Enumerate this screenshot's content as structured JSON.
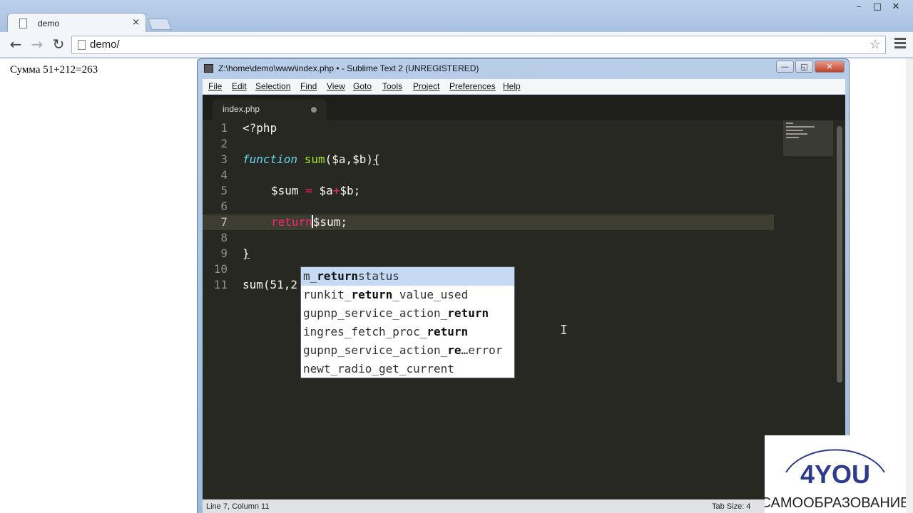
{
  "browser": {
    "tab_title": "demo",
    "tab_close": "×",
    "url": "demo/",
    "window_controls": [
      "–",
      "□",
      "✕"
    ],
    "nav": {
      "back": "←",
      "forward": "→",
      "reload": "↻",
      "star": "☆"
    }
  },
  "page": {
    "output_text": "Сумма 51+212=263"
  },
  "sublime": {
    "title": "Z:\\home\\demo\\www\\index.php • - Sublime Text 2 (UNREGISTERED)",
    "window_controls": [
      "—",
      "◱",
      "✕"
    ],
    "menu": [
      "File",
      "Edit",
      "Selection",
      "Find",
      "View",
      "Goto",
      "Tools",
      "Project",
      "Preferences",
      "Help"
    ],
    "file_tab": "index.php",
    "line_numbers": [
      "1",
      "2",
      "3",
      "4",
      "5",
      "6",
      "7",
      "8",
      "9",
      "10",
      "11"
    ],
    "code": {
      "l1": "<?php",
      "l3_kw": "function",
      "l3_name": "sum",
      "l3_args": "($a,$b)",
      "l3_brace": "{",
      "l5_var": "$sum",
      "l5_eq": "=",
      "l5_a": "$a",
      "l5_plus": "+",
      "l5_b": "$b;",
      "l7_kw": "return",
      "l7_rest": "$sum;",
      "l9": "}",
      "l11": "sum(51,2"
    },
    "autocomplete": [
      {
        "pre": "m_",
        "bold": "return",
        "post": "status"
      },
      {
        "pre": "runkit_",
        "bold": "return",
        "post": "_value_used"
      },
      {
        "pre": "gupnp_service_action_",
        "bold": "return",
        "post": ""
      },
      {
        "pre": "ingres_fetch_proc_",
        "bold": "return",
        "post": ""
      },
      {
        "pre": "gupnp_service_action_",
        "bold": "re",
        "post": "…error"
      },
      {
        "pre": "newt_radio_get_current",
        "bold": "",
        "post": ""
      }
    ],
    "status": {
      "position": "Line 7, Column 11",
      "tab_size": "Tab Size: 4"
    }
  },
  "watermark": {
    "brand": "4YOU",
    "tagline": "САМООБРАЗОВАНИЕ"
  }
}
